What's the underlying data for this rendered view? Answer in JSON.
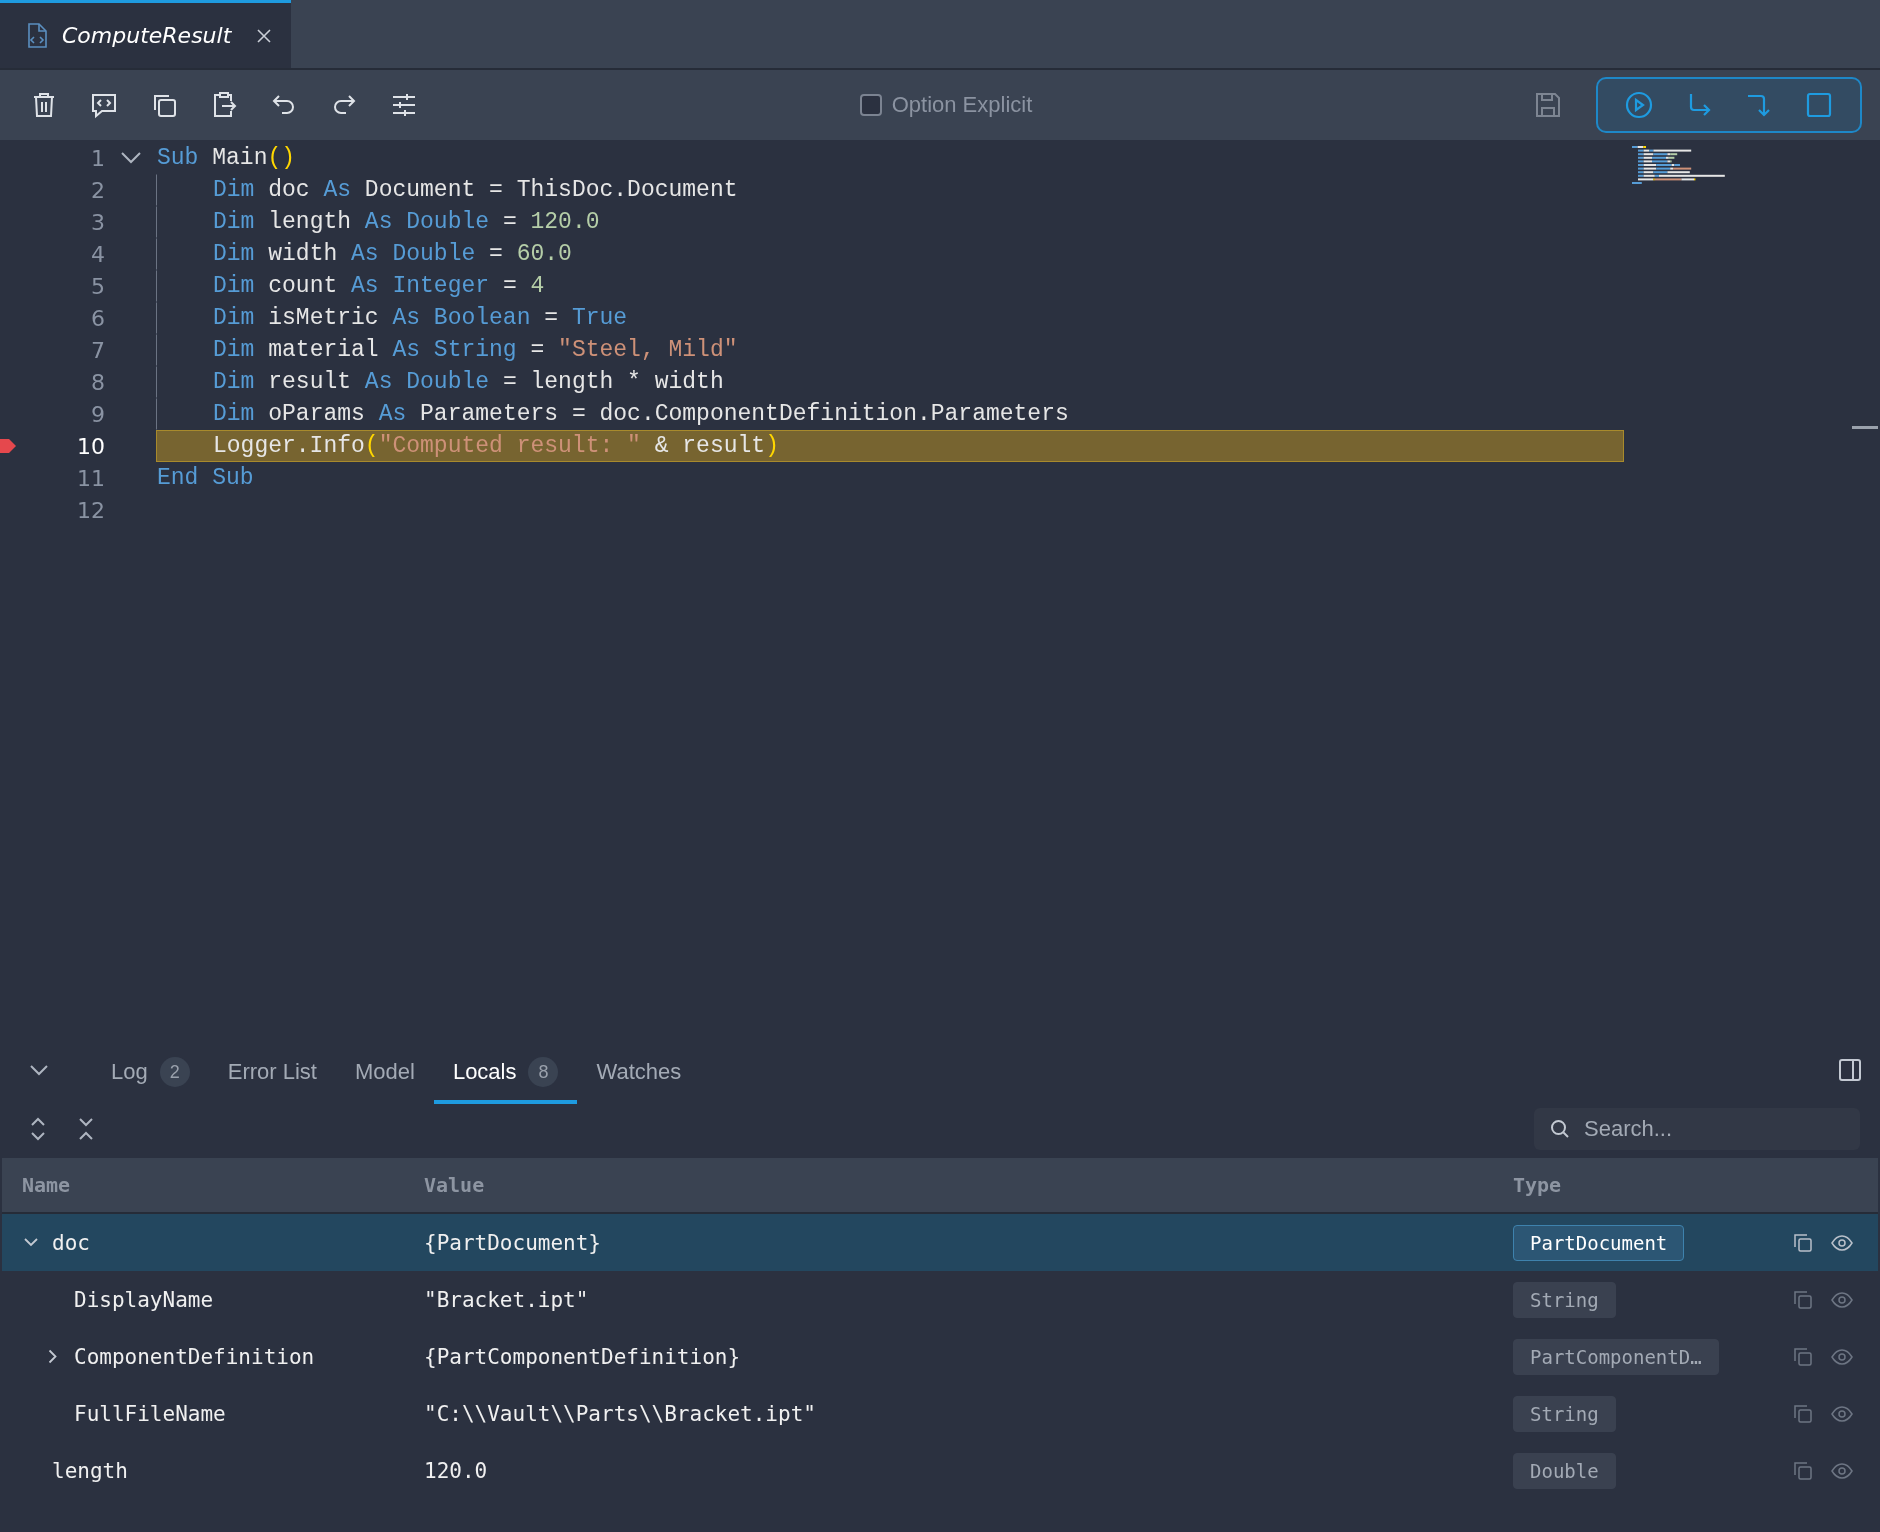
{
  "tabs": [
    {
      "label": "ComputeResult",
      "selected": true
    }
  ],
  "toolbar": {
    "option_explicit": {
      "label": "Option Explicit",
      "checked": false
    }
  },
  "editor": {
    "lines": [
      {
        "number": "1",
        "expanded": true,
        "breakpoint": false,
        "current": false,
        "tokens": [
          {
            "kind": "kw",
            "t": "Sub "
          },
          {
            "kind": "id",
            "t": "Main"
          },
          {
            "kind": "paren",
            "t": "()"
          }
        ],
        "children": [
          {
            "number": "2",
            "breakpoint": false,
            "current": false,
            "tokens": [
              {
                "kind": "kw",
                "t": "Dim "
              },
              {
                "kind": "id",
                "t": "doc "
              },
              {
                "kind": "kw",
                "t": "As "
              },
              {
                "kind": "id",
                "t": "Document = ThisDoc.Document"
              }
            ]
          },
          {
            "number": "3",
            "breakpoint": false,
            "current": false,
            "tokens": [
              {
                "kind": "kw",
                "t": "Dim "
              },
              {
                "kind": "id",
                "t": "length "
              },
              {
                "kind": "kw",
                "t": "As Double "
              },
              {
                "kind": "id",
                "t": "= "
              },
              {
                "kind": "num",
                "t": "120.0"
              }
            ]
          },
          {
            "number": "4",
            "breakpoint": false,
            "current": false,
            "tokens": [
              {
                "kind": "kw",
                "t": "Dim "
              },
              {
                "kind": "id",
                "t": "width "
              },
              {
                "kind": "kw",
                "t": "As Double "
              },
              {
                "kind": "id",
                "t": "= "
              },
              {
                "kind": "num",
                "t": "60.0"
              }
            ]
          },
          {
            "number": "5",
            "breakpoint": false,
            "current": false,
            "tokens": [
              {
                "kind": "kw",
                "t": "Dim "
              },
              {
                "kind": "id",
                "t": "count "
              },
              {
                "kind": "kw",
                "t": "As Integer "
              },
              {
                "kind": "id",
                "t": "= "
              },
              {
                "kind": "num",
                "t": "4"
              }
            ]
          },
          {
            "number": "6",
            "breakpoint": false,
            "current": false,
            "tokens": [
              {
                "kind": "kw",
                "t": "Dim "
              },
              {
                "kind": "id",
                "t": "isMetric "
              },
              {
                "kind": "kw",
                "t": "As Boolean "
              },
              {
                "kind": "id",
                "t": "= "
              },
              {
                "kind": "kw",
                "t": "True"
              }
            ]
          },
          {
            "number": "7",
            "breakpoint": false,
            "current": false,
            "tokens": [
              {
                "kind": "kw",
                "t": "Dim "
              },
              {
                "kind": "id",
                "t": "material "
              },
              {
                "kind": "kw",
                "t": "As String "
              },
              {
                "kind": "id",
                "t": "= "
              },
              {
                "kind": "str",
                "t": "\"Steel, Mild\""
              }
            ]
          },
          {
            "number": "8",
            "breakpoint": false,
            "current": false,
            "tokens": [
              {
                "kind": "kw",
                "t": "Dim "
              },
              {
                "kind": "id",
                "t": "result "
              },
              {
                "kind": "kw",
                "t": "As Double "
              },
              {
                "kind": "id",
                "t": "= length * width"
              }
            ]
          },
          {
            "number": "9",
            "breakpoint": false,
            "current": false,
            "tokens": [
              {
                "kind": "kw",
                "t": "Dim "
              },
              {
                "kind": "id",
                "t": "oParams "
              },
              {
                "kind": "kw",
                "t": "As "
              },
              {
                "kind": "id",
                "t": "Parameters = doc.ComponentDefinition.Parameters"
              }
            ]
          },
          {
            "number": "10",
            "breakpoint": true,
            "current": true,
            "tokens": [
              {
                "kind": "id",
                "t": "Logger.Info"
              },
              {
                "kind": "paren",
                "t": "("
              },
              {
                "kind": "str",
                "t": "\"Computed result: \""
              },
              {
                "kind": "id",
                "t": " & result"
              },
              {
                "kind": "paren",
                "t": ")"
              }
            ]
          }
        ]
      },
      {
        "number": "11",
        "breakpoint": false,
        "current": false,
        "tokens": [
          {
            "kind": "kw",
            "t": "End Sub"
          }
        ]
      },
      {
        "number": "12",
        "breakpoint": false,
        "current": false
      }
    ]
  },
  "panel": {
    "tabs": [
      {
        "label": "Log",
        "count": "2",
        "selected": false
      },
      {
        "label": "Error List",
        "selected": false
      },
      {
        "label": "Model",
        "selected": false
      },
      {
        "label": "Locals",
        "count": "8",
        "selected": true
      },
      {
        "label": "Watches",
        "selected": false
      }
    ],
    "search": {
      "placeholder": "Search..."
    },
    "table": {
      "columns": [
        "Name",
        "Value",
        "Type"
      ],
      "rows": [
        {
          "name": "doc",
          "value": "{PartDocument}",
          "type": "PartDocument",
          "expanded": true,
          "selected": true,
          "children": [
            {
              "name": "DisplayName",
              "value": "\"Bracket.ipt\"",
              "type": "String",
              "selected": false
            },
            {
              "name": "ComponentDefinition",
              "value": "{PartComponentDefinition}",
              "type": "PartComponentD…",
              "expanded": false,
              "selected": false
            },
            {
              "name": "FullFileName",
              "value": "\"C:\\\\Vault\\\\Parts\\\\Bracket.ipt\"",
              "type": "String",
              "selected": false
            }
          ]
        },
        {
          "name": "length",
          "value": "120.0",
          "type": "Double",
          "selected": false
        }
      ]
    }
  }
}
